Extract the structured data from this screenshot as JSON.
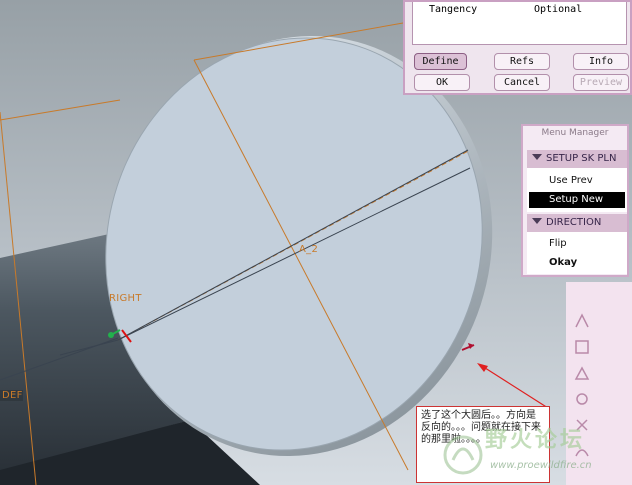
{
  "viewport": {
    "datum_labels": {
      "axis": "A_2",
      "plane_right": "RIGHT",
      "plane_def": "DEF"
    }
  },
  "feature_dialog": {
    "table_row": {
      "element": "Tangency",
      "info": "Optional"
    },
    "buttons": {
      "define": "Define",
      "refs": "Refs",
      "info": "Info",
      "ok": "OK",
      "cancel": "Cancel",
      "preview": "Preview"
    }
  },
  "menu_manager": {
    "title": "Menu Manager",
    "sections": [
      {
        "header": "SETUP SK PLN",
        "items": [
          "Use Prev",
          "Setup New"
        ]
      },
      {
        "header": "DIRECTION",
        "items": [
          "Flip",
          "Okay"
        ]
      }
    ],
    "selected_item": "Setup New"
  },
  "annotation": {
    "text": "选了这个大圆后。。方向是反向的。。。问题就在接下来的那里啦。。。。"
  },
  "watermark": {
    "title": "野火论坛",
    "url": "www.proewildfire.cn"
  },
  "colors": {
    "disc_fill": "#c3cfdb",
    "datum_orange": "#c87a2a",
    "dialog_bg": "#efe5ee",
    "menu_highlight": "#000000",
    "arrow_red": "#e02020"
  }
}
